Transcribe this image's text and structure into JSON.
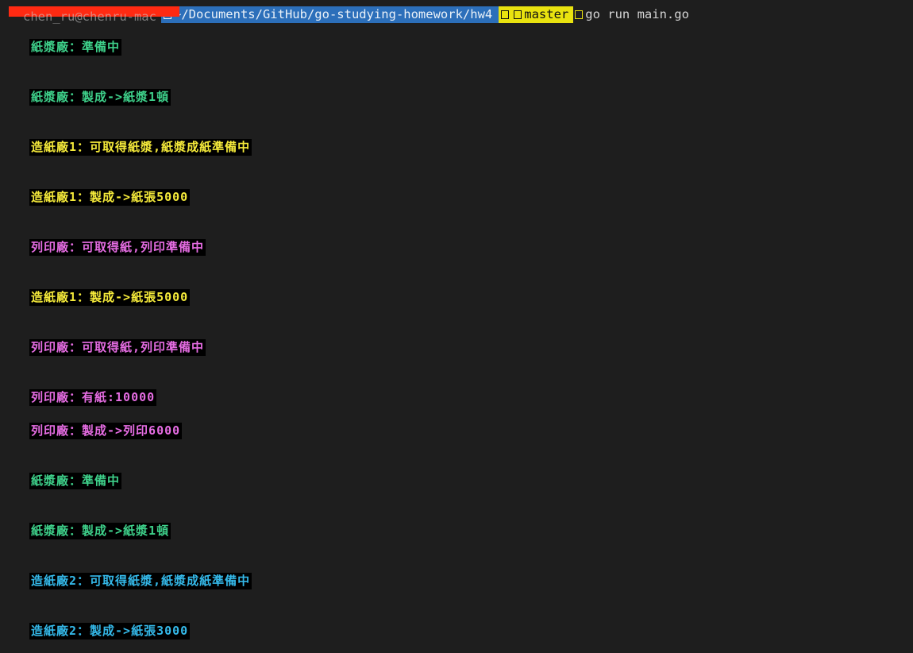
{
  "prompt": {
    "user_host": "chen_ru@chenru-mac",
    "path": "~/Documents/GitHub/go-studying-homework/hw4",
    "git_branch": "master",
    "command": "go run main.go"
  },
  "colors": {
    "background": "#1e1e1e",
    "path_segment": "#2c6fba",
    "git_segment": "#e9e20f",
    "redaction": "#ff2a12",
    "pulp_factory": "#3ed08a",
    "paper_factory_1": "#f5ea3a",
    "print_factory": "#e56ce2",
    "paper_factory_2": "#34b8e8"
  },
  "output": [
    {
      "text": "紙漿廠：準備中",
      "color": "green"
    },
    {
      "text": "紙漿廠：製成->紙漿1頓",
      "color": "green"
    },
    {
      "text": "造紙廠1：可取得紙漿,紙漿成紙準備中",
      "color": "yellow"
    },
    {
      "text": "造紙廠1：製成->紙張5000",
      "color": "yellow"
    },
    {
      "text": "列印廠：可取得紙,列印準備中",
      "color": "magenta"
    },
    {
      "text": "造紙廠1：製成->紙張5000",
      "color": "yellow"
    },
    {
      "text": "列印廠：可取得紙,列印準備中",
      "color": "magenta"
    },
    {
      "text": "列印廠：有紙:10000",
      "color": "magenta"
    },
    {
      "text": "列印廠：製成->列印6000",
      "color": "magenta"
    },
    {
      "text": "紙漿廠：準備中",
      "color": "green"
    },
    {
      "text": "紙漿廠：製成->紙漿1頓",
      "color": "green"
    },
    {
      "text": "造紙廠2：可取得紙漿,紙漿成紙準備中",
      "color": "cyan"
    },
    {
      "text": "造紙廠2：製成->紙張3000",
      "color": "cyan"
    }
  ]
}
